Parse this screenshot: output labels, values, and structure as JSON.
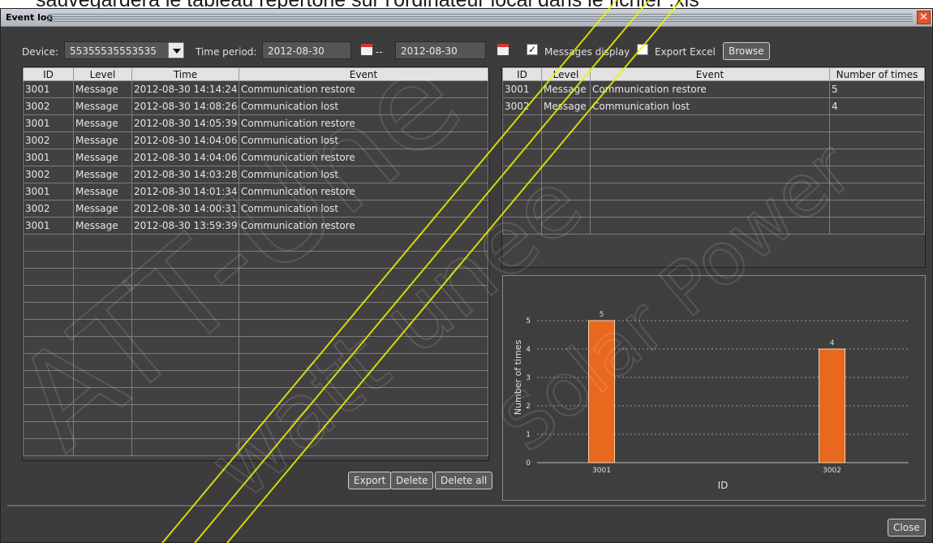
{
  "background_text": "sauvegardera le tableau répertorié sur l'ordinateur local dans le fichier .xls",
  "window": {
    "title": "Event log"
  },
  "toolbar": {
    "device_label": "Device:",
    "device_value": "55355535553535",
    "time_period_label": "Time period:",
    "date_from": "2012-08-30",
    "date_separator": "--",
    "date_to": "2012-08-30",
    "messages_display_label": "Messages display",
    "messages_display_checked": true,
    "export_excel_label": "Export Excel",
    "export_excel_checked": false,
    "browse_label": "Browse"
  },
  "event_table": {
    "columns": [
      "ID",
      "Level",
      "Time",
      "Event"
    ],
    "rows": [
      [
        "3001",
        "Message",
        "2012-08-30 14:14:24",
        "Communication restore"
      ],
      [
        "3002",
        "Message",
        "2012-08-30 14:08:26",
        "Communication lost"
      ],
      [
        "3001",
        "Message",
        "2012-08-30 14:05:39",
        "Communication restore"
      ],
      [
        "3002",
        "Message",
        "2012-08-30 14:04:06",
        "Communication lost"
      ],
      [
        "3001",
        "Message",
        "2012-08-30 14:04:06",
        "Communication restore"
      ],
      [
        "3002",
        "Message",
        "2012-08-30 14:03:28",
        "Communication lost"
      ],
      [
        "3001",
        "Message",
        "2012-08-30 14:01:34",
        "Communication restore"
      ],
      [
        "3002",
        "Message",
        "2012-08-30 14:00:31",
        "Communication lost"
      ],
      [
        "3001",
        "Message",
        "2012-08-30 13:59:39",
        "Communication restore"
      ]
    ]
  },
  "summary_table": {
    "columns": [
      "ID",
      "Level",
      "Event",
      "Number of times"
    ],
    "rows": [
      [
        "3001",
        "Message",
        "Communication restore",
        "5"
      ],
      [
        "3002",
        "Message",
        "Communication lost",
        "4"
      ]
    ]
  },
  "buttons": {
    "export": "Export",
    "delete": "Delete",
    "delete_all": "Delete all",
    "close": "Close"
  },
  "colors": {
    "bar": "#e8681e",
    "accent_close": "#e5532a"
  },
  "chart_data": {
    "type": "bar",
    "categories": [
      "3001",
      "3002"
    ],
    "values": [
      5,
      4
    ],
    "data_labels": [
      "5",
      "4"
    ],
    "xlabel": "ID",
    "ylabel": "Number of times",
    "ylim": [
      0,
      6
    ],
    "yticks": [
      0,
      1,
      2,
      3,
      4,
      5
    ],
    "grid": true
  },
  "watermark": {
    "lines": [
      "ATT-Une",
      "watt unee",
      "Solar Power"
    ]
  }
}
